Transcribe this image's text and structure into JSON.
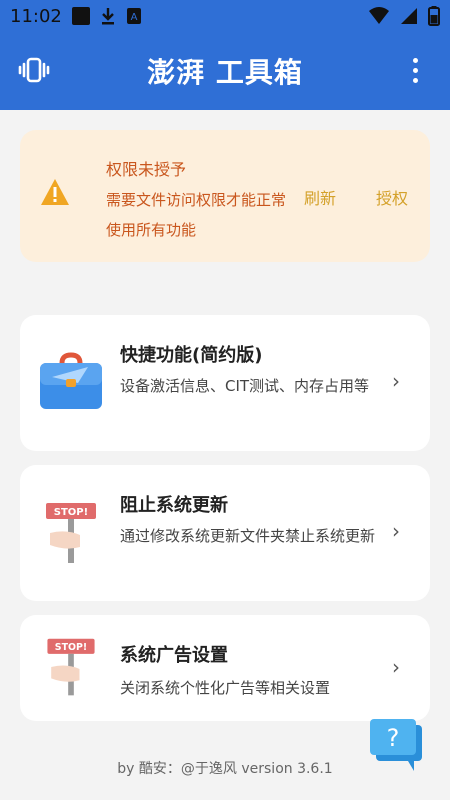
{
  "status_bar": {
    "time": "11:02"
  },
  "app_bar": {
    "title": "澎湃 工具箱"
  },
  "warning": {
    "title": "权限未授予",
    "description": "需要文件访问权限才能正常使用所有功能",
    "refresh_label": "刷新",
    "grant_label": "授权",
    "accent": "#d4a12a"
  },
  "cards": [
    {
      "title": "快捷功能(简约版)",
      "description": "设备激活信息、CIT测试、内存占用等",
      "icon": "briefcase-icon"
    },
    {
      "title": "阻止系统更新",
      "description": "通过修改系统更新文件夹禁止系统更新",
      "icon": "stop-sign-icon"
    },
    {
      "title": "系统广告设置",
      "description": "关闭系统个性化广告等相关设置",
      "icon": "stop-sign-icon"
    }
  ],
  "stop_text": "STOP!",
  "footer": "by 酷安：@于逸风 version 3.6.1",
  "fab_label": "?",
  "colors": {
    "primary": "#2f6fd6",
    "warning_bg": "#fdefdc",
    "warning_text": "#c9561d"
  }
}
